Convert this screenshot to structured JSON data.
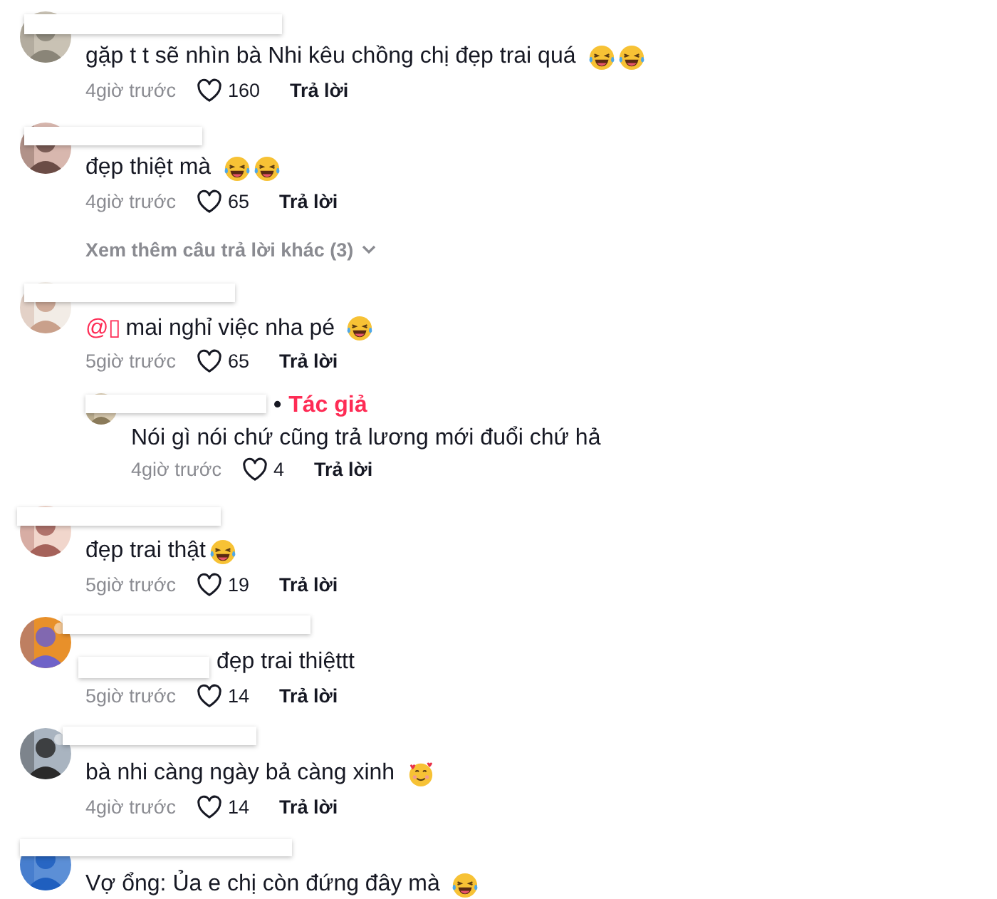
{
  "items": [
    {
      "kind": "comment",
      "text": "gặp t t sẽ nhìn bà Nhi kêu chồng chị đẹp trai quá",
      "emojis": [
        {
          "kind": "laugh"
        },
        {
          "kind": "laugh"
        }
      ],
      "time": "4giờ trước",
      "likes": "160",
      "reply_label": "Trả lời"
    },
    {
      "kind": "comment",
      "text": "đẹp thiệt mà",
      "emojis": [
        {
          "kind": "laugh"
        },
        {
          "kind": "laugh"
        }
      ],
      "time": "4giờ trước",
      "likes": "65",
      "reply_label": "Trả lời"
    },
    {
      "kind": "more",
      "label": "Xem thêm câu trả lời khác (3)"
    },
    {
      "kind": "comment",
      "mention": "@▯",
      "text": "mai nghỉ việc nha pé",
      "emojis": [
        {
          "kind": "laugh"
        }
      ],
      "time": "5giờ trước",
      "likes": "65",
      "reply_label": "Trả lời"
    },
    {
      "kind": "reply",
      "separator": "•",
      "badge": "Tác giả",
      "text": "Nói gì nói chứ cũng trả lương mới đuổi chứ hả",
      "time": "4giờ trước",
      "likes": "4",
      "reply_label": "Trả lời"
    },
    {
      "kind": "comment",
      "text": "đẹp trai thật",
      "emojis": [
        {
          "kind": "laugh"
        }
      ],
      "time": "5giờ trước",
      "likes": "19",
      "reply_label": "Trả lời"
    },
    {
      "kind": "comment",
      "redacted_prefix": true,
      "text": "đẹp trai thiệttt",
      "time": "5giờ trước",
      "likes": "14",
      "reply_label": "Trả lời"
    },
    {
      "kind": "comment",
      "text": "bà nhi càng ngày bả càng xinh",
      "emojis": [
        {
          "kind": "hearts"
        }
      ],
      "time": "4giờ trước",
      "likes": "14",
      "reply_label": "Trả lời"
    },
    {
      "kind": "comment",
      "text": "Vợ ổng: Ủa e chị còn đứng đây mà",
      "emojis": [
        {
          "kind": "laugh"
        }
      ]
    }
  ]
}
